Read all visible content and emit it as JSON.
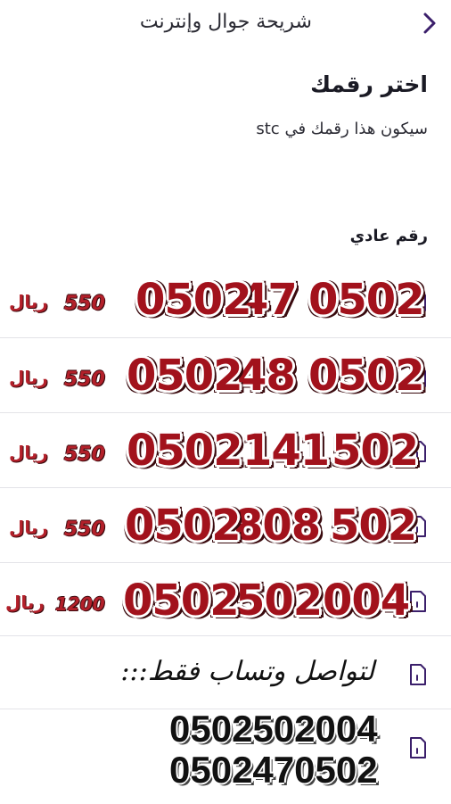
{
  "header": {
    "title": "شريحة جوال وإنترنت"
  },
  "page": {
    "choose_title": "اختر رقمك",
    "choose_subtitle": "سيكون هذا رقمك في stc",
    "section_label": "رقم عادي"
  },
  "colors": {
    "accent": "#3b1f6b",
    "number_red": "#a2121c"
  },
  "numbers": [
    {
      "part1": "0502",
      "part2": "47",
      "part3": "0502",
      "price": "550",
      "currency": "ريال"
    },
    {
      "part1": "0502",
      "part2": "48",
      "part3": "0502",
      "price": "550",
      "currency": "ريال"
    },
    {
      "part1": "502",
      "part2": "141",
      "part3": "0502",
      "price": "550",
      "currency": "ريال"
    },
    {
      "part1": "502",
      "part2": "808",
      "part3": "0502",
      "price": "550",
      "currency": "ريال"
    },
    {
      "part1": "004",
      "part2": "502",
      "part3": "0502",
      "price": "1200",
      "currency": "ريال"
    }
  ],
  "contact": {
    "note": "لتواصل وتساب فقط:::",
    "phone1": "0502502004",
    "phone2": "0502470502"
  }
}
